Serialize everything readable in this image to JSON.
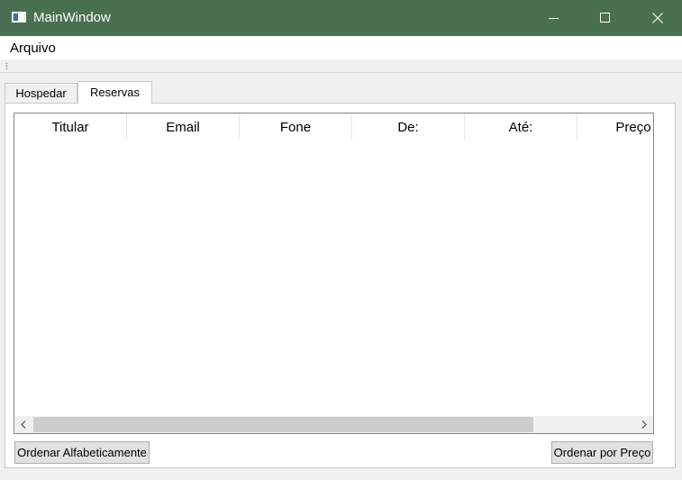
{
  "window": {
    "title": "MainWindow",
    "titlebar_color": "#4a7052",
    "controls": [
      "minimize-icon",
      "maximize-icon",
      "close-icon"
    ]
  },
  "menubar": {
    "items": [
      {
        "label": "Arquivo"
      }
    ]
  },
  "tabs": [
    {
      "label": "Hospedar",
      "active": false
    },
    {
      "label": "Reservas",
      "active": true
    }
  ],
  "table": {
    "columns": [
      "Titular",
      "Email",
      "Fone",
      "De:",
      "Até:",
      "Preço"
    ],
    "rows": []
  },
  "buttons": {
    "sort_alpha": "Ordenar Alfabeticamente",
    "sort_price": "Ordenar por Preço"
  }
}
